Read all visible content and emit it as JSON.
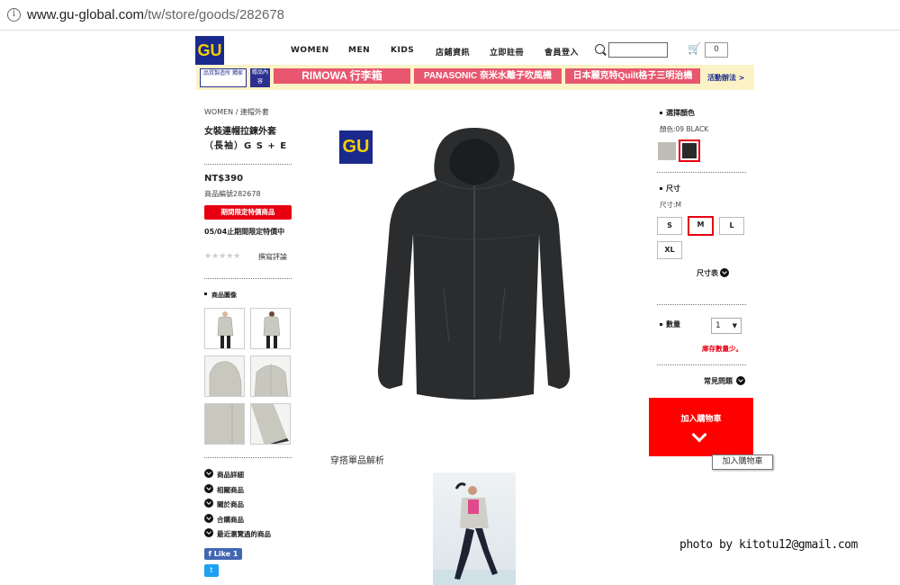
{
  "browser": {
    "url_domain": "www.gu-global.com",
    "url_path": "/tw/store/goods/282678"
  },
  "header": {
    "logo": "GU",
    "nav": [
      "WOMEN",
      "MEN",
      "KIDS",
      "店鋪資訊",
      "立即註冊",
      "會員登入"
    ],
    "search_placeholder": "",
    "cart_count": "0"
  },
  "banner": {
    "badge1": "品質製造所 獨家",
    "badge2": "贈品內容",
    "promos": [
      "RIMOWA 行李箱",
      "PANASONIC 奈米水離子吹風機",
      "日本麗克特Quilt格子三明治機"
    ],
    "more": "活動辦法 >"
  },
  "product": {
    "breadcrumb": "WOMEN / 連帽外套",
    "title_line1": "女裝連帽拉鍊外套",
    "title_line2": "（長袖）G S + E",
    "price": "NT$390",
    "code": "商品編號282678",
    "limited_badge": "期間限定特價商品",
    "limited_note": "05/04止期間限定特價中",
    "rating_stars": "★★★★★",
    "review_link": "撰寫評論",
    "images_heading": "商品圖像",
    "brand_logo": "GU"
  },
  "left_menu": [
    "商品詳細",
    "相關商品",
    "關於商品",
    "合購商品",
    "最近瀏覽過的商品"
  ],
  "social": {
    "like": "f Like 1",
    "twitter": "t"
  },
  "coord": {
    "title": "穿搭單品解析"
  },
  "options": {
    "color_heading": "選擇顏色",
    "color_value": "顏色:09 BLACK",
    "swatches": [
      {
        "name": "gray",
        "color": "#bdbdb5",
        "selected": false
      },
      {
        "name": "black",
        "color": "#2a2a2a",
        "selected": true
      }
    ],
    "size_heading": "尺寸",
    "size_value": "尺寸:M",
    "sizes": [
      "S",
      "M",
      "L",
      "XL"
    ],
    "selected_size": "M",
    "size_chart": "尺寸表",
    "qty_label": "數量",
    "qty_value": "1",
    "stock_warning": "庫存數量少。",
    "faq": "常見問題",
    "add_to_cart": "加入購物車",
    "tooltip": "加入購物車"
  },
  "watermark": "photo by kitotu12@gmail.com",
  "colors": {
    "brand_navy": "#1a2a8c",
    "brand_yellow": "#f5d000",
    "accent_red": "#e60012",
    "cart_red": "#ff0000"
  }
}
